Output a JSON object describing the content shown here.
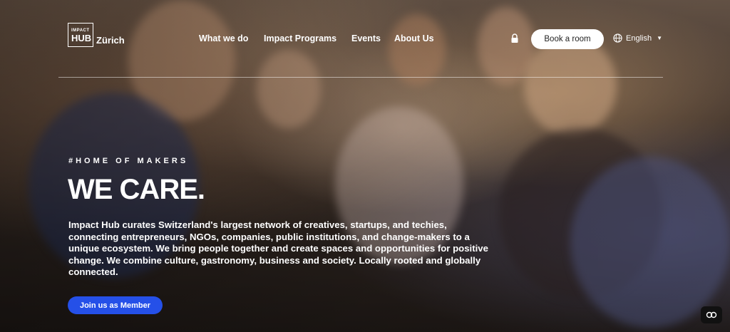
{
  "brand": {
    "logo_small": "IMPACT",
    "logo_big": "HUB",
    "city": "Zürich"
  },
  "nav": {
    "items": [
      {
        "label": "What we do"
      },
      {
        "label": "Impact Programs"
      },
      {
        "label": "Events"
      },
      {
        "label": "About Us"
      }
    ],
    "book_label": "Book a room",
    "language": "English"
  },
  "hero": {
    "eyebrow": "#HOME OF MAKERS",
    "headline": "WE CARE.",
    "body": "Impact Hub curates Switzerland's largest network of creatives, startups, and techies, connecting entrepreneurs, NGOs, companies, public institutions, and change-makers to a unique ecosystem. We bring people together and create spaces and opportunities for positive change. We combine culture, gastronomy, business and society. Locally rooted and globally connected.",
    "cta_label": "Join us as Member"
  },
  "icons": {
    "lock": "lock-icon",
    "globe": "globe-icon",
    "caret": "caret-down-icon",
    "chat": "chat-icon"
  },
  "colors": {
    "cta": "#2550e8",
    "book_button_bg": "#ffffff"
  }
}
